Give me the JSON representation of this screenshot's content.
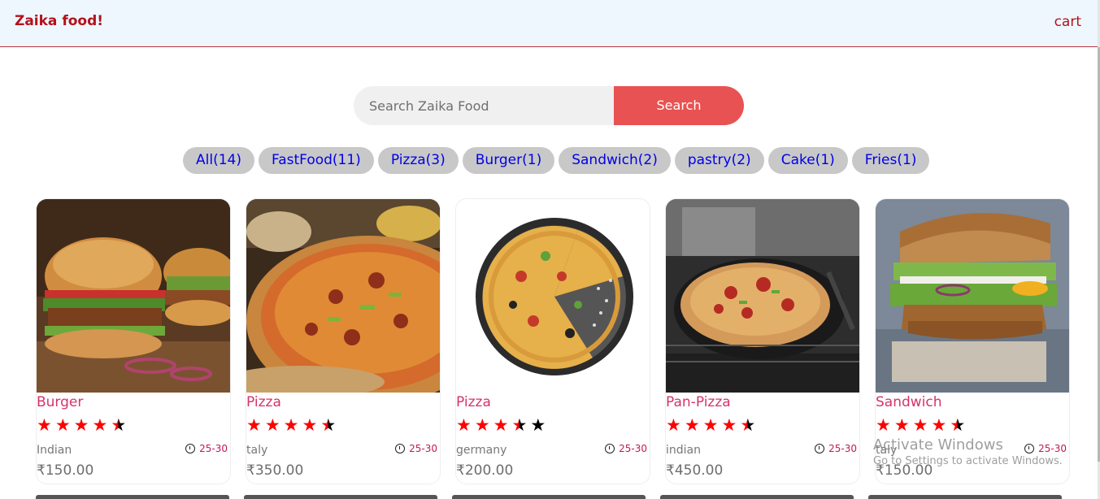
{
  "navbar": {
    "brand": "Zaika food!",
    "cart": "cart"
  },
  "search": {
    "placeholder": "Search Zaika Food",
    "value": "",
    "button_label": "Search"
  },
  "filters": [
    "All(14)",
    "FastFood(11)",
    "Pizza(3)",
    "Burger(1)",
    "Sandwich(2)",
    "pastry(2)",
    "Cake(1)",
    "Fries(1)"
  ],
  "cards": [
    {
      "title": "Burger",
      "rating": 4.5,
      "origin": "Indian",
      "time": "25-30",
      "price": "₹150.00",
      "image": "burger-image"
    },
    {
      "title": "Pizza",
      "rating": 4.5,
      "origin": "taly",
      "time": "25-30",
      "price": "₹350.00",
      "image": "pizza-image"
    },
    {
      "title": "Pizza",
      "rating": 3.5,
      "origin": "germany",
      "time": "25-30",
      "price": "₹200.00",
      "image": "pizza-pan-image"
    },
    {
      "title": "Pan-Pizza",
      "rating": 4.5,
      "origin": "indian",
      "time": "25-30",
      "price": "₹450.00",
      "image": "pan-pizza-image"
    },
    {
      "title": "Sandwich",
      "rating": 4.5,
      "origin": "taly",
      "time": "25-30",
      "price": "₹150.00",
      "image": "sandwich-image"
    }
  ],
  "watermark": {
    "line1": "Activate Windows",
    "line2": "Go to Settings to activate Windows."
  },
  "colors": {
    "brand": "#b3121b",
    "search_button": "#e85252",
    "chip_bg": "#c8c8c8",
    "chip_text": "#0000e6",
    "title_pink": "#d6336c",
    "star_red": "#ff0000"
  }
}
